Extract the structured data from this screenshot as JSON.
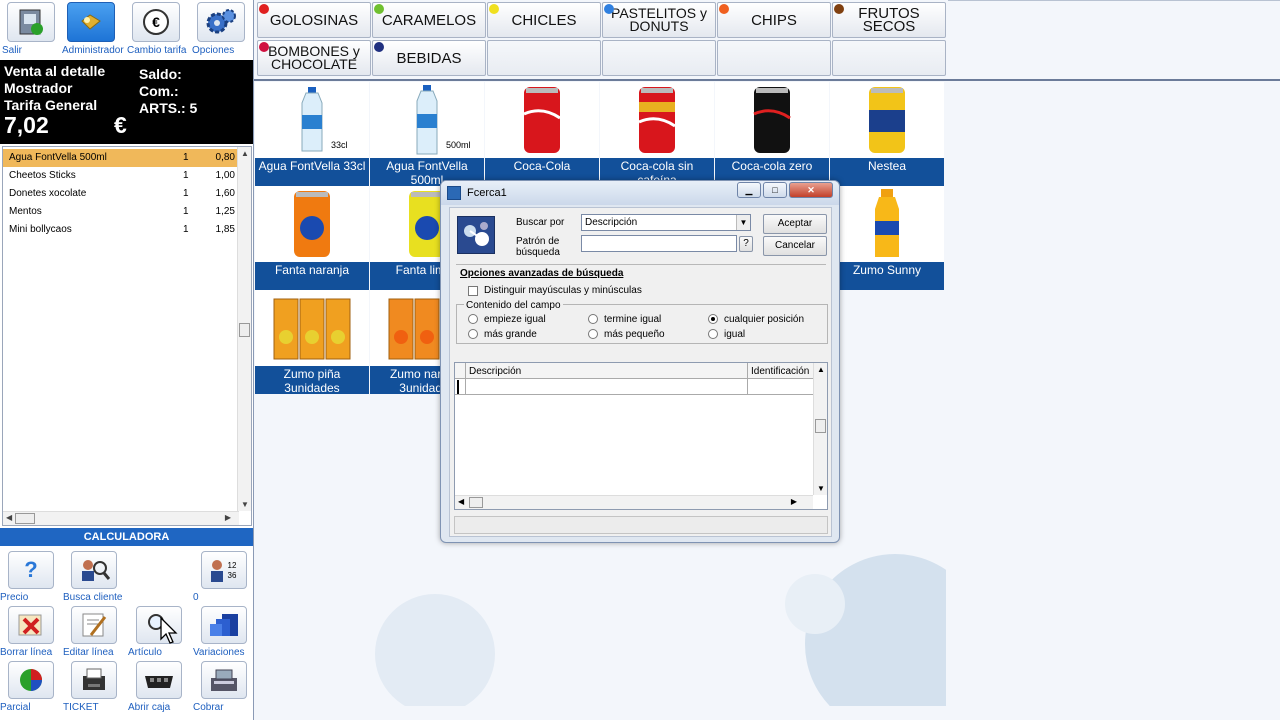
{
  "toolbar": {
    "items": [
      {
        "label": "Salir",
        "icon": "exit-icon"
      },
      {
        "label": "Administrador",
        "icon": "admin-icon"
      },
      {
        "label": "Cambio tarifa",
        "icon": "euro-icon"
      },
      {
        "label": "Opciones",
        "icon": "gear-icon"
      }
    ]
  },
  "sale": {
    "type": "Venta al detalle",
    "location": "Mostrador",
    "tariff": "Tarifa General",
    "balance_label": "Saldo:",
    "com_label": "Com.:",
    "arts_label": "ARTS.: 5",
    "total": "7,02",
    "currency": "€"
  },
  "lines": [
    {
      "name": "Agua FontVella 500ml",
      "qty": "1",
      "price": "0,80"
    },
    {
      "name": "Cheetos Sticks",
      "qty": "1",
      "price": "1,00"
    },
    {
      "name": "Donetes xocolate",
      "qty": "1",
      "price": "1,60"
    },
    {
      "name": "Mentos",
      "qty": "1",
      "price": "1,25"
    },
    {
      "name": "Mini bollycaos",
      "qty": "1",
      "price": "1,85"
    }
  ],
  "calculator_label": "CALCULADORA",
  "bottom_buttons": [
    {
      "label": "Precio",
      "icon": "question-icon"
    },
    {
      "label": "Busca cliente",
      "icon": "search-client-icon"
    },
    {
      "label": "0",
      "icon": "user-numbers-icon"
    },
    {
      "label": "Borrar línea",
      "icon": "delete-line-icon"
    },
    {
      "label": "Editar línea",
      "icon": "edit-line-icon"
    },
    {
      "label": "Artículo",
      "icon": "magnifier-icon"
    },
    {
      "label": "Variaciones",
      "icon": "variations-icon"
    },
    {
      "label": "Parcial",
      "icon": "pie-chart-icon"
    },
    {
      "label": "TICKET",
      "icon": "printer-icon"
    },
    {
      "label": "Abrir caja",
      "icon": "cash-drawer-icon"
    },
    {
      "label": "Cobrar",
      "icon": "register-icon"
    }
  ],
  "categories": [
    {
      "label": "GOLOSINAS",
      "color": "#e02020"
    },
    {
      "label": "CARAMELOS",
      "color": "#70c030"
    },
    {
      "label": "CHICLES",
      "color": "#f0e020"
    },
    {
      "label": "PASTELITOS y DONUTS",
      "color": "#3080e0"
    },
    {
      "label": "CHIPS",
      "color": "#f06020"
    },
    {
      "label": "FRUTOS SECOS",
      "color": "#804010"
    },
    {
      "label": "BOMBONES y CHOCOLATE",
      "color": "#d01040"
    },
    {
      "label": "BEBIDAS",
      "color": "#203080"
    }
  ],
  "products": [
    {
      "name": "Agua FontVella 33cl",
      "tag": "33cl"
    },
    {
      "name": "Agua FontVella 500ml",
      "tag": "500ml"
    },
    {
      "name": "Coca-Cola",
      "tag": ""
    },
    {
      "name": "Coca-cola sin cafeína",
      "tag": ""
    },
    {
      "name": "Coca-cola zero",
      "tag": ""
    },
    {
      "name": "Nestea",
      "tag": ""
    },
    {
      "name": "Fanta naranja",
      "tag": ""
    },
    {
      "name": "Fanta limón",
      "tag": ""
    },
    {
      "name": "Zumo Sunny",
      "tag": ""
    },
    {
      "name": "Zumo piña 3unidades",
      "tag": ""
    },
    {
      "name": "Zumo naranja 3unidades",
      "tag": ""
    }
  ],
  "dialog": {
    "title": "Fcerca1",
    "search_by_label": "Buscar por",
    "search_by_value": "Descripción",
    "pattern_label": "Patrón de búsqueda",
    "help_label": "?",
    "accept_label": "Aceptar",
    "cancel_label": "Cancelar",
    "advanced_label": "Opciones avanzadas de búsqueda",
    "case_label": "Distinguir mayúsculas y minúsculas",
    "field_content_label": "Contenido del campo",
    "options": [
      {
        "label": "empieze igual",
        "checked": false
      },
      {
        "label": "termine igual",
        "checked": false
      },
      {
        "label": "cualquier posición",
        "checked": true
      },
      {
        "label": "más grande",
        "checked": false
      },
      {
        "label": "más pequeño",
        "checked": false
      },
      {
        "label": "igual",
        "checked": false
      }
    ],
    "columns": [
      "Descripción",
      "Identificación"
    ]
  }
}
